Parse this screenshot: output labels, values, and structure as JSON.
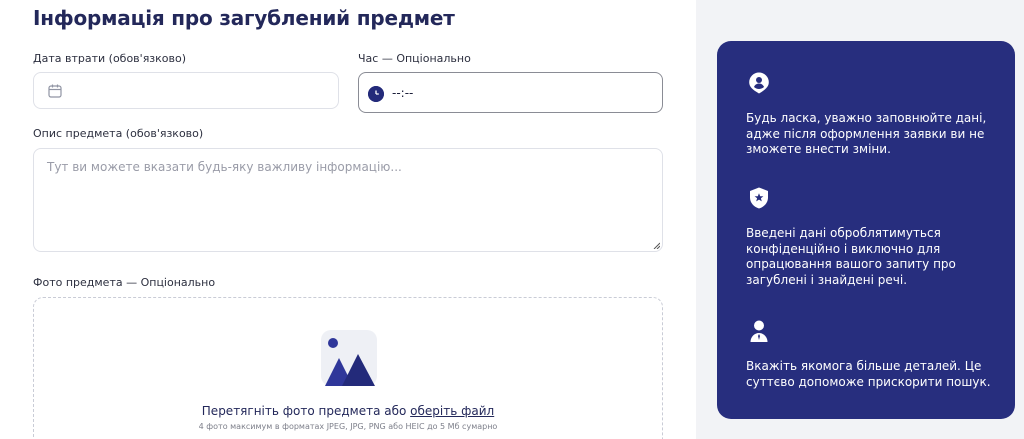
{
  "form": {
    "title": "Інформація про загублений предмет",
    "date": {
      "label": "Дата втрати (обов'язково)",
      "value": "",
      "icon": "calendar-icon"
    },
    "time": {
      "label": "Час — Опціонально",
      "value": "--:--",
      "icon": "clock-icon"
    },
    "description": {
      "label": "Опис предмета (обов'язково)",
      "placeholder": "Тут ви можете вказати будь-яку важливу інформацію..."
    },
    "photo": {
      "label": "Фото предмета — Опціонально",
      "drop_text": "Перетягніть фото предмета або ",
      "link_text": "оберіть файл",
      "hint": "4 фото максимум в форматах JPEG, JPG, PNG або HEIC до 5 Мб сумарно",
      "icon": "image-upload-icon"
    }
  },
  "info_card": {
    "background": "#272e7e",
    "items": [
      {
        "icon": "user-badge-icon",
        "text": "Будь ласка, уважно заповнюйте дані, адже після оформлення заявки ви не зможете внести зміни."
      },
      {
        "icon": "shield-star-icon",
        "text": "Введені дані оброблятимуться конфіденційно і виключно для опрацювання вашого запиту про загублені і знайдені речі."
      },
      {
        "icon": "person-icon",
        "text": "Вкажіть якомога більше деталей. Це суттєво допоможе прискорити пошук."
      }
    ]
  },
  "colors": {
    "accent": "#272e7e",
    "text": "#23285a",
    "border": "#dfe1e8"
  }
}
